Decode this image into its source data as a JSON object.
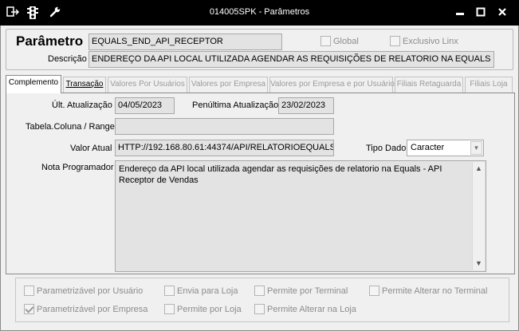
{
  "window": {
    "title": "014005SPK - Parâmetros",
    "icons": [
      "exit-icon",
      "traffic-light-icon",
      "wrench-icon"
    ],
    "buttons": [
      "minimize-button",
      "maximize-button",
      "close-button"
    ]
  },
  "header": {
    "parametro_label": "Parâmetro",
    "parametro_value": "EQUALS_END_API_RECEPTOR",
    "descricao_label": "Descrição",
    "descricao_value": "ENDEREÇO DA API LOCAL UTILIZADA AGENDAR AS REQUISIÇÕES DE RELATORIO NA EQUALS",
    "global_label": "Global",
    "exclusivo_linx_label": "Exclusivo Linx"
  },
  "tabs": [
    {
      "label": "Complemento",
      "state": "active"
    },
    {
      "label": "Transação",
      "state": "enabled"
    },
    {
      "label": "Valores Por Usuários",
      "state": "disabled"
    },
    {
      "label": "Valores por Empresa",
      "state": "disabled"
    },
    {
      "label": "Valores por Empresa e por Usuário",
      "state": "disabled"
    },
    {
      "label": "Filiais Retaguarda",
      "state": "disabled"
    },
    {
      "label": "Filiais Loja",
      "state": "disabled"
    }
  ],
  "complemento": {
    "ult_atualizacao_label": "Últ. Atualização",
    "ult_atualizacao_value": "04/05/2023",
    "penultima_label": "Penúltima Atualização",
    "penultima_value": "23/02/2023",
    "tabela_label": "Tabela.Coluna / Range",
    "tabela_value": "",
    "valor_atual_label": "Valor Atual",
    "valor_atual_value": "HTTP://192.168.80.61:44374/API/RELATORIOEQUALS",
    "tipo_dado_label": "Tipo Dado",
    "tipo_dado_value": "Caracter",
    "nota_label": "Nota Programador",
    "nota_value": "Endereço da API local utilizada agendar as requisições de relatorio na Equals - API Receptor de Vendas"
  },
  "options": {
    "parametrizavel_usuario": {
      "label": "Parametrizável por Usuário",
      "checked": false
    },
    "envia_loja": {
      "label": "Envia para Loja",
      "checked": false
    },
    "permite_terminal": {
      "label": "Permite por Terminal",
      "checked": false
    },
    "permite_alterar_terminal": {
      "label": "Permite Alterar no Terminal",
      "checked": false
    },
    "parametrizavel_empresa": {
      "label": "Parametrizável por Empresa",
      "checked": true
    },
    "permite_loja": {
      "label": "Permite por Loja",
      "checked": false
    },
    "permite_alterar_loja": {
      "label": "Permite Alterar na Loja",
      "checked": false
    }
  }
}
